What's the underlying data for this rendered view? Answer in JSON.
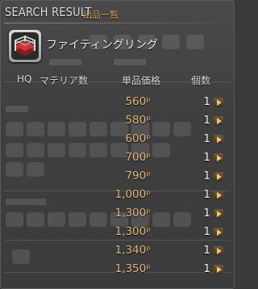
{
  "header": {
    "title": "SEARCH RESULT",
    "subtitle": "出品一覧"
  },
  "item": {
    "name": "ファイティングリング",
    "icon": "fighting-ring-icon"
  },
  "columns": {
    "hq": "HQ",
    "materia": "マテリア数",
    "unit_price": "単品価格",
    "quantity": "個数"
  },
  "listings": [
    {
      "price": "560",
      "qty": "1"
    },
    {
      "price": "580",
      "qty": "1"
    },
    {
      "price": "600",
      "qty": "1"
    },
    {
      "price": "700",
      "qty": "1"
    },
    {
      "price": "790",
      "qty": "1"
    },
    {
      "price": "1,000",
      "qty": "1"
    },
    {
      "price": "1,300",
      "qty": "1"
    },
    {
      "price": "1,300",
      "qty": "1"
    },
    {
      "price": "1,340",
      "qty": "1"
    },
    {
      "price": "1,350",
      "qty": "1"
    }
  ],
  "currency_symbol": "ᵖ",
  "colors": {
    "price": "#e0b878",
    "subtitle": "#d4a35a",
    "panel": "#3f3f3f"
  }
}
